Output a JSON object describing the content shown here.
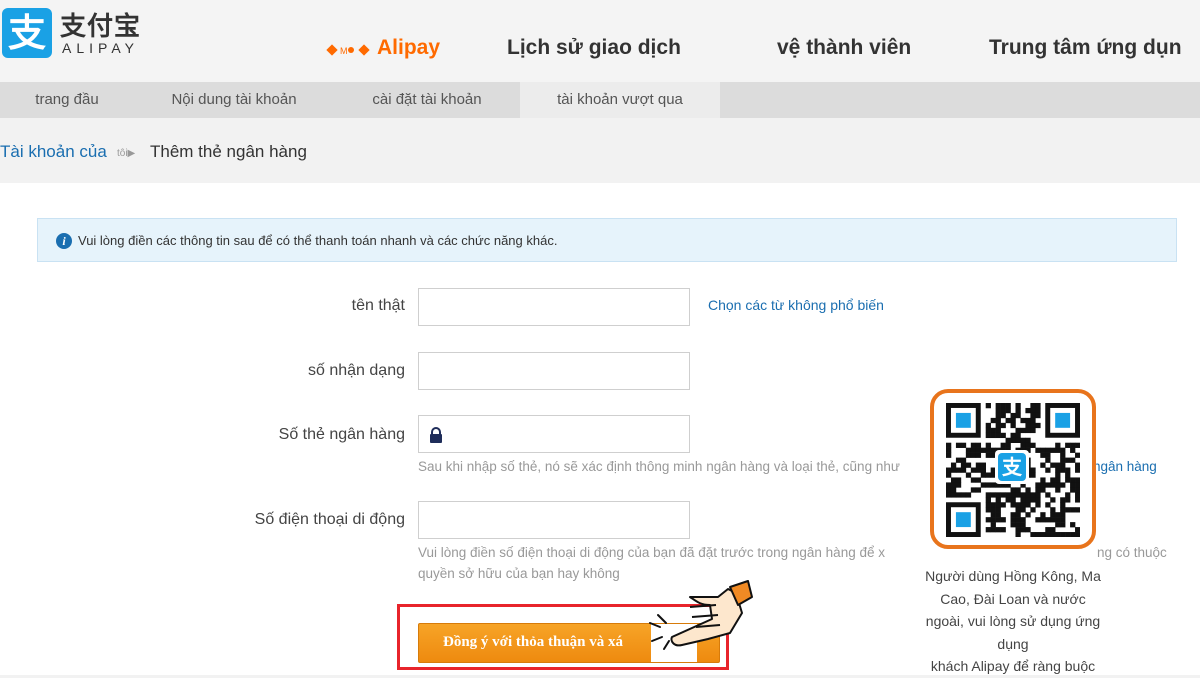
{
  "header": {
    "logo_cn": "支付宝",
    "logo_en": "ALIPAY",
    "logo_glyph": "支",
    "nav": [
      {
        "label": "Alipay",
        "active": true
      },
      {
        "label": "Lịch sử giao dịch",
        "active": false
      },
      {
        "label": "vệ thành viên",
        "active": false
      },
      {
        "label": "Trung tâm ứng dụn",
        "active": false
      }
    ]
  },
  "subnav": {
    "tabs": [
      {
        "label": "trang đầu"
      },
      {
        "label": "Nội dung tài khoản"
      },
      {
        "label": "cài đặt tài khoản"
      },
      {
        "label": "tài khoản vượt qua",
        "active": true
      }
    ]
  },
  "breadcrumb": {
    "parent": "Tài khoản của",
    "separator": "tôi▶",
    "current": "Thêm thẻ ngân hàng"
  },
  "notice": {
    "icon": "info-icon",
    "text": "Vui lòng điền các thông tin sau để có thể thanh toán nhanh và các chức năng khác."
  },
  "form": {
    "real_name": {
      "label": "tên thật",
      "value": "",
      "link": "Chọn các từ không phổ biến"
    },
    "id_number": {
      "label": "số nhận dạng",
      "value": ""
    },
    "bank_card": {
      "label": "Số thẻ ngân hàng",
      "value": "",
      "icon": "lock-icon",
      "hint": "Sau khi nhập số thẻ, nó sẽ xác định thông minh ngân hàng và loại thẻ, cũng như",
      "hint_link": "ngân hàng"
    },
    "phone": {
      "label": "Số điện thoại di động",
      "value": "",
      "hint_line1": "Vui lòng điền số điện thoại di động của bạn đã đặt trước trong ngân hàng để x",
      "hint_line1_tail": "ng có thuộc",
      "hint_line2": "quyền sở hữu của bạn hay không"
    },
    "submit_label": "Đồng ý với thỏa thuận và xá"
  },
  "qr": {
    "center_glyph": "支",
    "caption": [
      "Người dùng Hồng Kông, Ma",
      "Cao, Đài Loan và nước",
      "ngoài, vui lòng sử dụng ứng",
      "dụng",
      "khách Alipay để ràng buộc"
    ]
  },
  "colors": {
    "brand_blue": "#1aa1e5",
    "active_orange": "#ff6a00",
    "link_blue": "#1a6eb0",
    "button_orange": "#f29a1c",
    "highlight_red": "#e8242b",
    "qr_frame_orange": "#e8741c"
  }
}
